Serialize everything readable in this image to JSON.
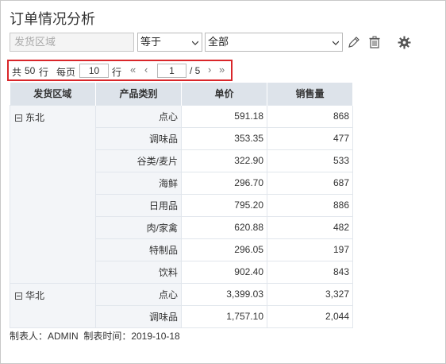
{
  "page_title": "订单情况分析",
  "filter": {
    "field_placeholder": "发货区域",
    "operator": "等于",
    "value": "全部"
  },
  "pager": {
    "total_prefix": "共",
    "total": "50",
    "total_suffix": "行",
    "per_page_label": "每页",
    "per_page": "10",
    "per_page_suffix": "行",
    "first": "«",
    "prev": "‹",
    "current_page": "1",
    "of_label": "/ 5",
    "next": "›",
    "last": "»"
  },
  "table": {
    "headers": [
      "发货区域",
      "产品类别",
      "单价",
      "销售量"
    ],
    "groups": [
      {
        "region": "东北",
        "rows": [
          {
            "category": "点心",
            "price": "591.18",
            "qty": "868"
          },
          {
            "category": "调味品",
            "price": "353.35",
            "qty": "477"
          },
          {
            "category": "谷类/麦片",
            "price": "322.90",
            "qty": "533"
          },
          {
            "category": "海鲜",
            "price": "296.70",
            "qty": "687"
          },
          {
            "category": "日用品",
            "price": "795.20",
            "qty": "886"
          },
          {
            "category": "肉/家禽",
            "price": "620.88",
            "qty": "482"
          },
          {
            "category": "特制品",
            "price": "296.05",
            "qty": "197"
          },
          {
            "category": "饮料",
            "price": "902.40",
            "qty": "843"
          }
        ]
      },
      {
        "region": "华北",
        "rows": [
          {
            "category": "点心",
            "price": "3,399.03",
            "qty": "3,327"
          },
          {
            "category": "调味品",
            "price": "1,757.10",
            "qty": "2,044"
          }
        ]
      }
    ]
  },
  "footer": "制表人：ADMIN  制表时间：2019-10-18",
  "colors": {
    "header_bg": "#dde3ea",
    "pager_border": "#d9262a"
  },
  "icons": [
    "pencil-icon",
    "trash-icon",
    "gear-icon",
    "chevron-down-icon",
    "collapse-icon"
  ]
}
